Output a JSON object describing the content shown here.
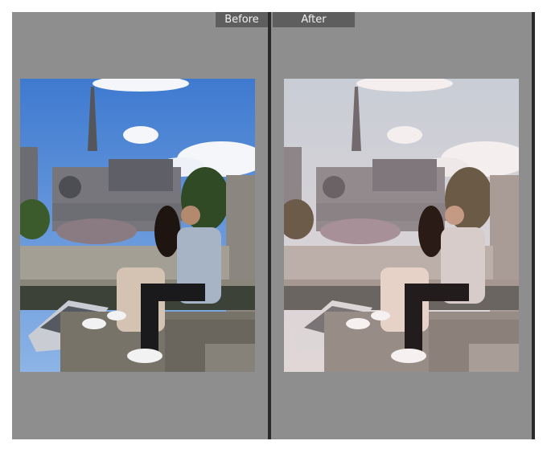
{
  "compare": {
    "before_label": "Before",
    "after_label": "After"
  },
  "colors": {
    "panel_bg": "#8e8e8e",
    "divider": "#2a2a2a",
    "label_bg": "#5e5e5e",
    "before_sky": "#4a86d4",
    "after_sky": "#d9d2d6"
  }
}
